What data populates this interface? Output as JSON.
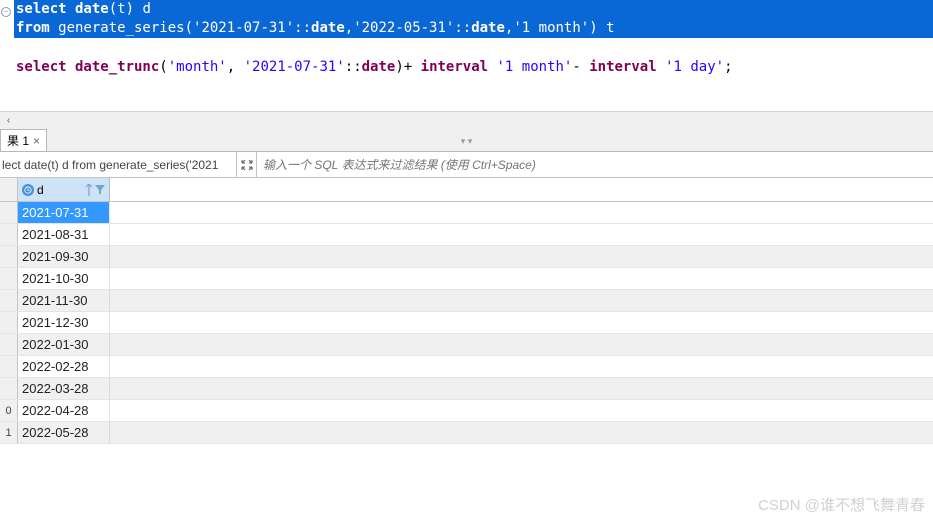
{
  "editor": {
    "line1": {
      "select": "select",
      "date": " date",
      "paren_t": "(t) ",
      "alias": "d"
    },
    "line2": {
      "from": "from",
      "func": " generate_series(",
      "d1": "'2021-07-31'",
      "cast1": "::",
      "type1": "date",
      "comma1": ",",
      "d2": "'2022-05-31'",
      "cast2": "::",
      "type2": "date",
      "comma2": ",",
      "int": "'1 month'",
      "close": ") t"
    },
    "line3": {
      "select": "select",
      "dtrunc": " date_trunc",
      "open": "(",
      "m": "'month'",
      "comma": ", ",
      "d": "'2021-07-31'",
      "cast": "::",
      "type": "date",
      "close": ")+ ",
      "interval1": "interval ",
      "i1": "'1 month'",
      "minus": "- ",
      "interval2": "interval ",
      "i2": "'1 day'",
      "semi": ";"
    }
  },
  "tab": {
    "label": "果 1",
    "close": "×"
  },
  "filter": {
    "query_preview": "lect date(t) d from generate_series('2021",
    "placeholder": "输入一个 SQL 表达式来过滤结果 (使用 Ctrl+Space)"
  },
  "column": {
    "name": "d"
  },
  "rows": [
    {
      "num": "",
      "d": "2021-07-31",
      "selected": true,
      "alt": false
    },
    {
      "num": "",
      "d": "2021-08-31",
      "selected": false,
      "alt": false
    },
    {
      "num": "",
      "d": "2021-09-30",
      "selected": false,
      "alt": true
    },
    {
      "num": "",
      "d": "2021-10-30",
      "selected": false,
      "alt": false
    },
    {
      "num": "",
      "d": "2021-11-30",
      "selected": false,
      "alt": true
    },
    {
      "num": "",
      "d": "2021-12-30",
      "selected": false,
      "alt": false
    },
    {
      "num": "",
      "d": "2022-01-30",
      "selected": false,
      "alt": true
    },
    {
      "num": "",
      "d": "2022-02-28",
      "selected": false,
      "alt": false
    },
    {
      "num": "",
      "d": "2022-03-28",
      "selected": false,
      "alt": true
    },
    {
      "num": "0",
      "d": "2022-04-28",
      "selected": false,
      "alt": false
    },
    {
      "num": "1",
      "d": "2022-05-28",
      "selected": false,
      "alt": true
    }
  ],
  "watermark": "CSDN @谁不想飞舞青春",
  "hscroll_left": "‹"
}
